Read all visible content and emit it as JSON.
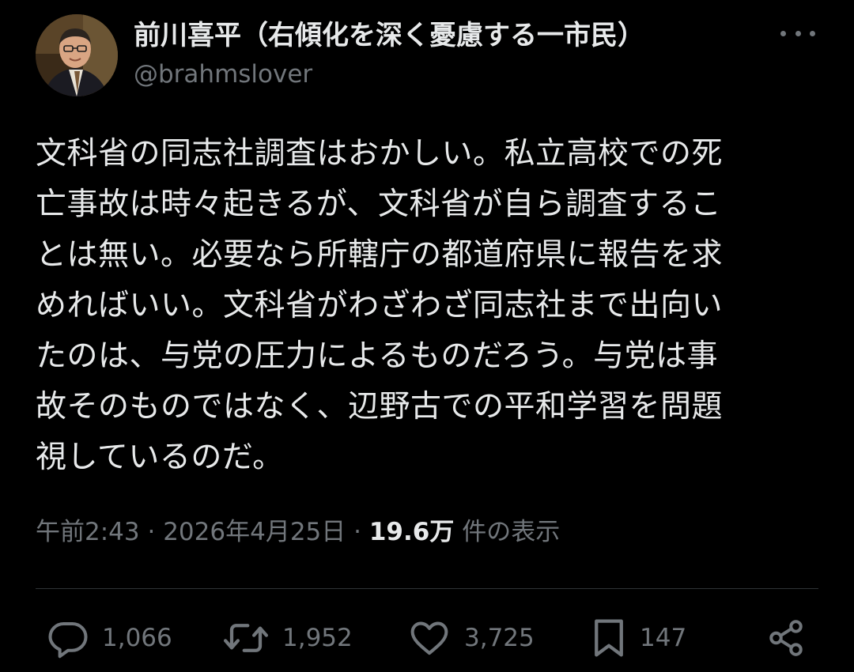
{
  "author": {
    "display_name": "前川喜平（右傾化を深く憂慮する一市民）",
    "handle": "@brahmslover",
    "avatar_icon": "profile-photo"
  },
  "tweet": {
    "text": "文科省の同志社調査はおかしい。私立高校での死\n亡事故は時々起きるが、文科省が自ら調査するこ\nとは無い。必要なら所轄庁の都道府県に報告を求\nめればいい。文科省がわざわざ同志社まで出向い\nたのは、与党の圧力によるものだろう。与党は事\n故そのものではなく、辺野古での平和学習を問題\n視しているのだ。"
  },
  "meta": {
    "time": "午前2:43",
    "separator": "·",
    "date": "2026年4月25日",
    "views_count": "19.6万",
    "views_label": "件の表示"
  },
  "actions": {
    "replies": "1,066",
    "retweets": "1,952",
    "likes": "3,725",
    "bookmarks": "147"
  },
  "colors": {
    "background": "#000000",
    "primary_text": "#e7e9ea",
    "secondary_text": "#71767b",
    "divider": "#2f3336"
  }
}
